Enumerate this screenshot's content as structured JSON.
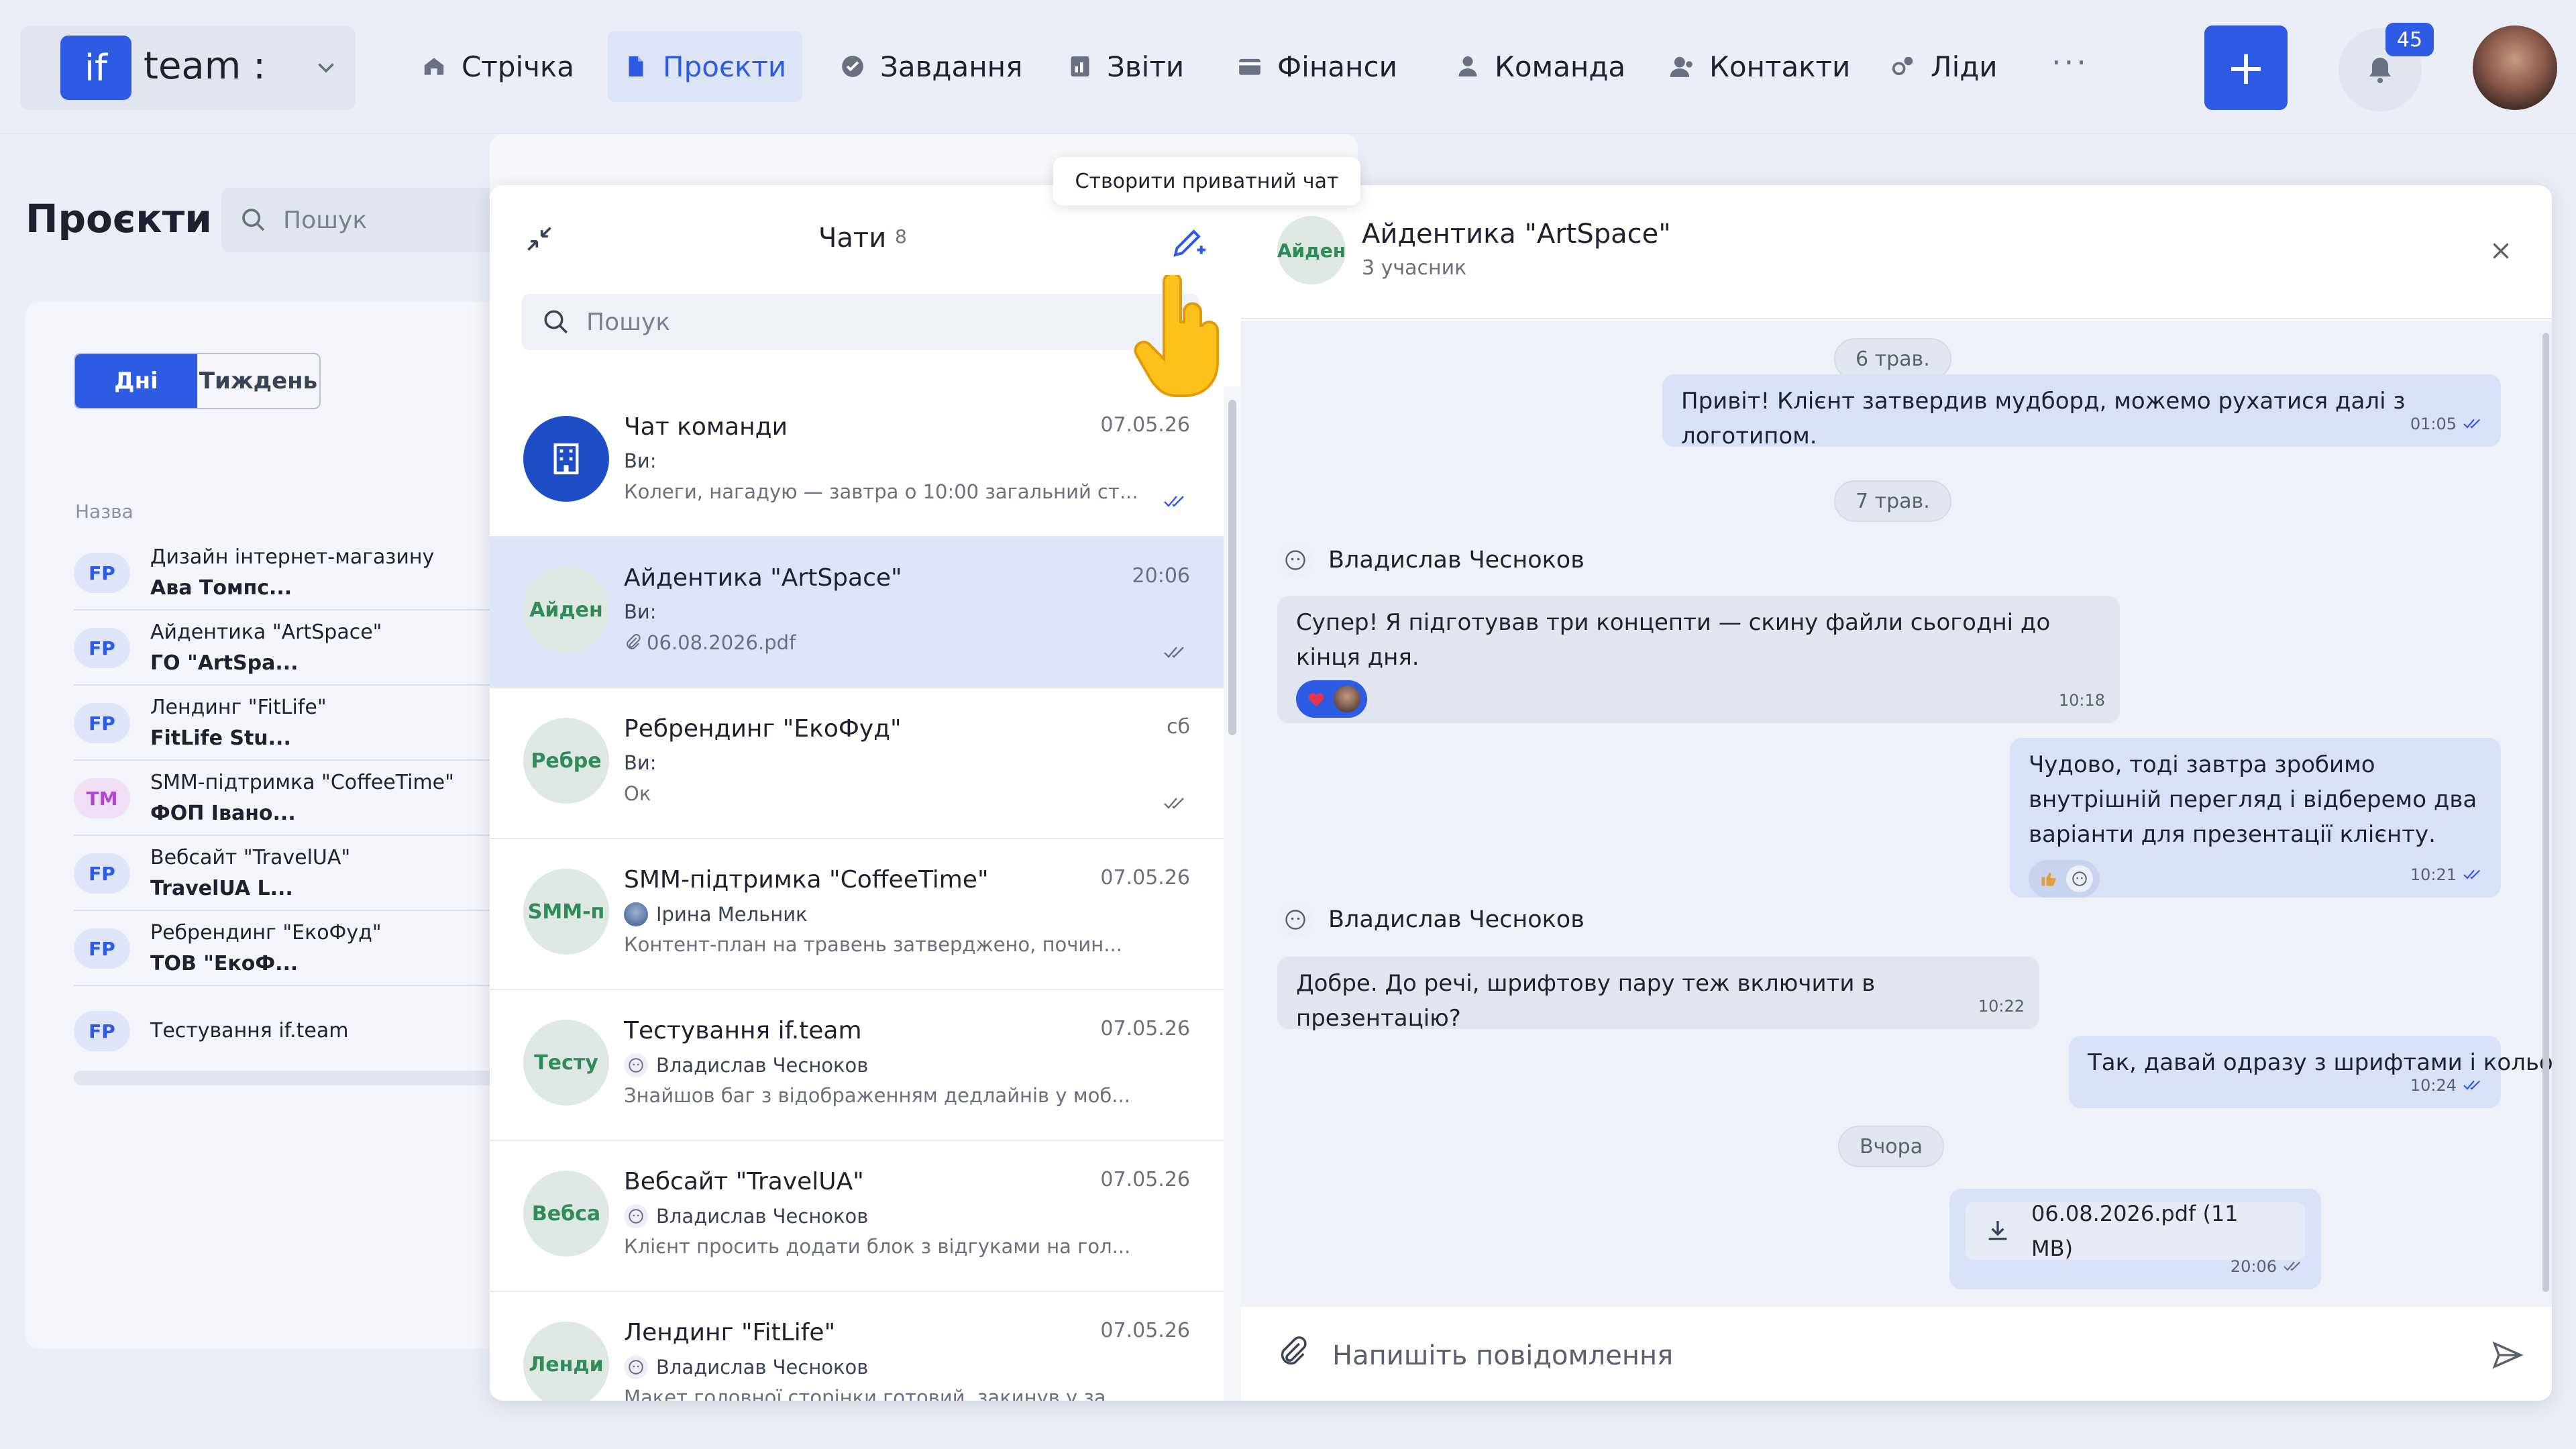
{
  "app": {
    "logo_text": "if",
    "brand": "team :"
  },
  "nav": {
    "items": [
      {
        "label": "Стрічка",
        "icon": "home-icon"
      },
      {
        "label": "Проєкти",
        "icon": "file-icon",
        "active": true
      },
      {
        "label": "Завдання",
        "icon": "check-circle-icon"
      },
      {
        "label": "Звіти",
        "icon": "report-icon"
      },
      {
        "label": "Фінанси",
        "icon": "wallet-icon"
      },
      {
        "label": "Команда",
        "icon": "user-icon"
      },
      {
        "label": "Контакти",
        "icon": "contacts-icon"
      },
      {
        "label": "Ліди",
        "icon": "leads-icon"
      }
    ],
    "more": "···",
    "add": "+",
    "notifications_count": "45"
  },
  "projects": {
    "title": "Проєкти",
    "search_placeholder": "Пошук",
    "toggle": {
      "days": "Дні",
      "week": "Тиждень"
    },
    "column_name": "Назва",
    "rows": [
      {
        "tag": "FP",
        "name": "Дизайн інтернет-магазину",
        "client": "Ава Томпс..."
      },
      {
        "tag": "FP",
        "name": "Айдентика \"ArtSpace\"",
        "client": "ГО \"ArtSpa..."
      },
      {
        "tag": "FP",
        "name": "Лендинг \"FitLife\"",
        "client": "FitLife Stu..."
      },
      {
        "tag": "TM",
        "name": "SMM-підтримка \"CoffeeTime\"",
        "client": "ФОП Івано..."
      },
      {
        "tag": "FP",
        "name": "Вебсайт \"TravelUA\"",
        "client": "TravelUA L..."
      },
      {
        "tag": "FP",
        "name": "Ребрендинг \"ЕкоФуд\"",
        "client": "ТОВ \"ЕкоФ..."
      },
      {
        "tag": "FP",
        "name": "Тестування if.team",
        "client": ""
      }
    ]
  },
  "chats": {
    "title": "Чати",
    "count": "8",
    "tooltip": "Створити приватний чат",
    "search_placeholder": "Пошук",
    "items": [
      {
        "avatar": "",
        "name": "Чат команди",
        "date": "07.05.26",
        "sender": "Ви:",
        "preview": "Колеги, нагадую — завтра о 10:00 загальний ст..."
      },
      {
        "avatar": "Айден",
        "name": "Айдентика \"ArtSpace\"",
        "date": "20:06",
        "sender": "Ви:",
        "preview": "06.08.2026.pdf"
      },
      {
        "avatar": "Ребре",
        "name": "Ребрендинг \"ЕкоФуд\"",
        "date": "сб",
        "sender": "Ви:",
        "preview": "Ок"
      },
      {
        "avatar": "SMM-п",
        "name": "SMM-підтримка \"CoffeeTime\"",
        "date": "07.05.26",
        "sender": "Ірина Мельник",
        "preview": "Контент-план на травень затверджено, почин..."
      },
      {
        "avatar": "Тесту",
        "name": "Тестування if.team",
        "date": "07.05.26",
        "sender": "Владислав Чесноков",
        "preview": "Знайшов баг з відображенням дедлайнів у моб..."
      },
      {
        "avatar": "Вебса",
        "name": "Вебсайт \"TravelUA\"",
        "date": "07.05.26",
        "sender": "Владислав Чесноков",
        "preview": "Клієнт просить додати блок з відгуками на гол..."
      },
      {
        "avatar": "Ленди",
        "name": "Лендинг \"FitLife\"",
        "date": "07.05.26",
        "sender": "Владислав Чесноков",
        "preview": "Макет головної сторінки готовий, закинув у за..."
      }
    ]
  },
  "conversation": {
    "avatar": "Айден",
    "title": "Айдентика \"ArtSpace\"",
    "subtitle": "3 учасник",
    "messages": {
      "d1": "6 трав.",
      "m1": {
        "text": "Привіт! Клієнт затвердив мудборд, можемо рухатися далі з логотипом.",
        "time": "01:05"
      },
      "d2": "7 трав.",
      "s1": "Владислав Чесноков",
      "m2": {
        "text": "Супер! Я підготував три концепти — скину файли сьогодні до кінця дня.",
        "time": "10:18"
      },
      "m3": {
        "text": "Чудово, тоді завтра зробимо внутрішній перегляд і відберемо два варіанти для презентації клієнту.",
        "time": "10:21"
      },
      "s2": "Владислав Чесноков",
      "m4": {
        "text": "Добре. До речі, шрифтову пару теж включити в презентацію?",
        "time": "10:22"
      },
      "m5": {
        "text": "Так, давай одразу з шрифтами і кольорами — щоб клієнт бачив повну картину.",
        "time": "10:24"
      },
      "d3": "Вчора",
      "file": {
        "name": "06.08.2026.pdf (11 MB)",
        "time": "20:06"
      }
    },
    "composer_placeholder": "Напишіть повідомлення"
  },
  "colors": {
    "accent": "#2d5be3",
    "background": "#ebeef6",
    "bubble_out": "#d9e1f7",
    "avatar_green": "#2f8b5a"
  }
}
